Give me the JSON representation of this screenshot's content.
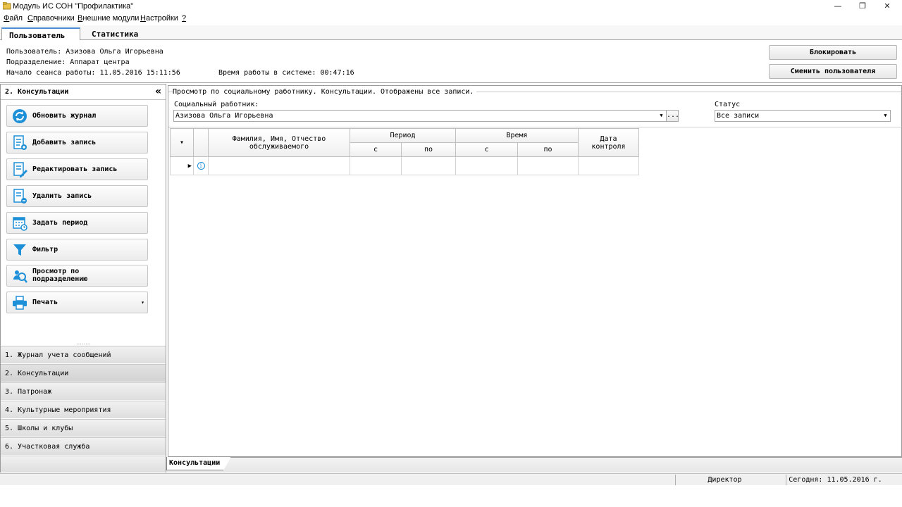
{
  "window": {
    "title": "Модуль ИС СОН \"Профилактика\"",
    "minimize": "—",
    "restore": "❐",
    "close": "✕"
  },
  "menu": {
    "file": "Файл",
    "file_key": "Ф",
    "file_rest": "айл",
    "refs_key": "С",
    "refs_rest": "правочники",
    "ext_key": "В",
    "ext_rest": "нешние модули",
    "settings_key": "Н",
    "settings_rest": "астройки",
    "help": "?"
  },
  "top_tabs": [
    {
      "label": "Пользователь",
      "active": true
    },
    {
      "label": "Статистика",
      "active": false
    }
  ],
  "session": {
    "user_line": "Пользователь: Азизова Ольга Игорьевна",
    "dept_line": "Подразделение: Аппарат центра",
    "start_line": "Начало сеанса работы: 11.05.2016 15:11:56",
    "uptime_line": "Время работы в системе: 00:47:16",
    "lock_button": "Блокировать",
    "switch_user_button": "Сменить пользователя"
  },
  "left_panel": {
    "title": "2. Консультации",
    "collapse": "«",
    "actions": [
      {
        "label": "Обновить журнал",
        "icon": "refresh-icon"
      },
      {
        "label": "Добавить запись",
        "icon": "add-record-icon"
      },
      {
        "label": "Редактировать запись",
        "icon": "edit-record-icon"
      },
      {
        "label": "Удалить запись",
        "icon": "delete-record-icon"
      },
      {
        "label": "Задать период",
        "icon": "calendar-icon"
      },
      {
        "label": "Фильтр",
        "icon": "filter-icon"
      },
      {
        "label_line1": "Просмотр по",
        "label_line2": "подразделению",
        "icon": "search-users-icon"
      },
      {
        "label": "Печать",
        "icon": "printer-icon",
        "dropdown": "▾"
      }
    ],
    "splitter": "........",
    "nav": [
      {
        "label": "1. Журнал учета сообщений",
        "selected": false
      },
      {
        "label": "2. Консультации",
        "selected": true
      },
      {
        "label": "3. Патронаж",
        "selected": false
      },
      {
        "label": "4. Культурные мероприятия",
        "selected": false
      },
      {
        "label": "5. Школы и клубы",
        "selected": false
      },
      {
        "label": "6. Участковая служба",
        "selected": false
      }
    ]
  },
  "main": {
    "group_title": "Просмотр по социальному работнику. Консультации. Отображены все записи.",
    "worker_label": "Социальный работник:",
    "worker_value": "Азизова Ольга Игорьевна",
    "ellipsis": "...",
    "status_label": "Статус",
    "status_value": "Все записи",
    "grid": {
      "col_name": "Фамилия, Имя, Отчество обслуживаемого",
      "col_period": "Период",
      "col_time": "Время",
      "col_control": "Дата контроля",
      "sub_from": "с",
      "sub_to": "по",
      "row_marker": "▶",
      "col_menu": "▾",
      "info_icon": "i"
    }
  },
  "bottom_tabs": [
    {
      "label": "Консультации"
    }
  ],
  "status": {
    "role": "Директор",
    "today": "Сегодня: 11.05.2016 г."
  },
  "colors": {
    "accent": "#4a8fd6",
    "icon_blue": "#1e90d8"
  }
}
